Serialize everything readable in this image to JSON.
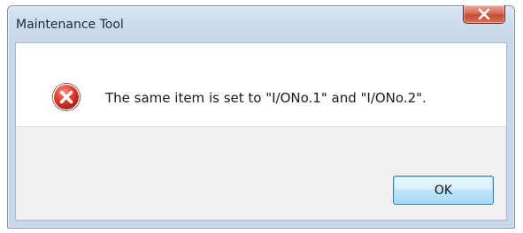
{
  "window": {
    "title": "Maintenance Tool",
    "close_icon": "close-x-icon"
  },
  "dialog": {
    "icon": "error-icon",
    "message": "The same item is set to \"I/ONo.1\" and \"I/ONo.2\".",
    "ok_label": "OK"
  },
  "colors": {
    "close_button": "#c24b34",
    "error_icon": "#d32f2f",
    "ok_border": "#3c7fb1"
  }
}
